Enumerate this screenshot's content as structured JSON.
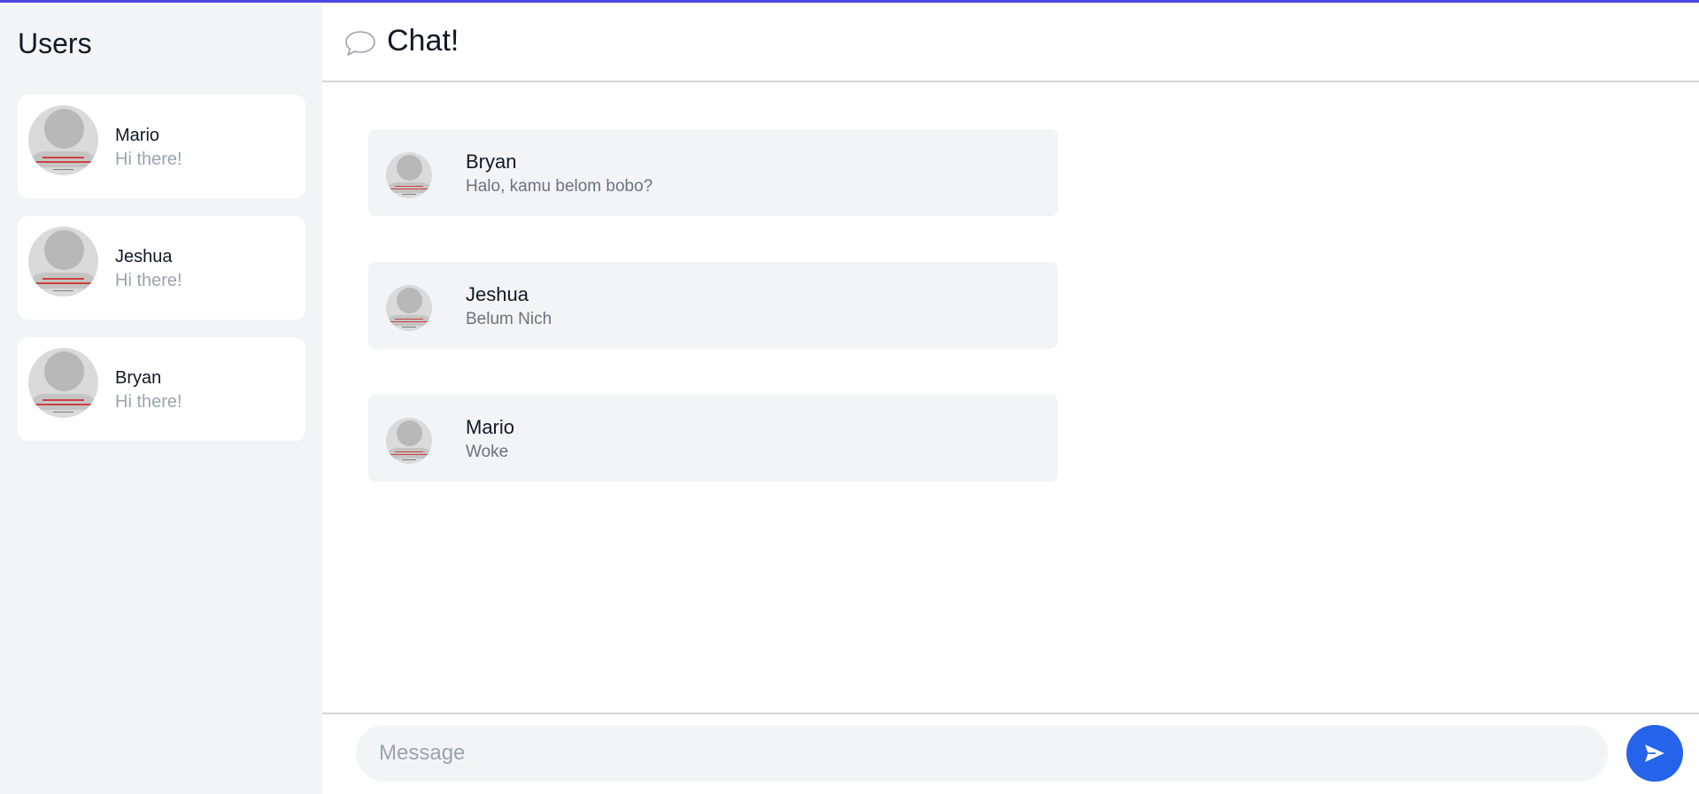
{
  "sidebar": {
    "title": "Users",
    "users": [
      {
        "name": "Mario",
        "last_message": "Hi there!"
      },
      {
        "name": "Jeshua",
        "last_message": "Hi there!"
      },
      {
        "name": "Bryan",
        "last_message": "Hi there!"
      }
    ]
  },
  "header": {
    "icon": "chat-bubble-icon",
    "title": "Chat!"
  },
  "messages": [
    {
      "name": "Bryan",
      "text": "Halo, kamu belom bobo?"
    },
    {
      "name": "Jeshua",
      "text": "Belum Nich"
    },
    {
      "name": "Mario",
      "text": "Woke"
    }
  ],
  "composer": {
    "placeholder": "Message",
    "value": "",
    "send_icon": "send-icon"
  },
  "colors": {
    "accent": "#2563eb",
    "topline": "#4f46e5",
    "sidebar_bg": "#f3f4f6"
  }
}
